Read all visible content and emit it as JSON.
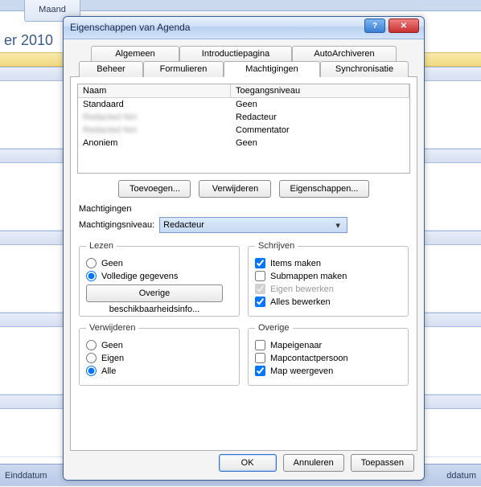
{
  "bg": {
    "maand_tab": "Maand",
    "date_header": "er 2010",
    "foot_left": "Einddatum",
    "foot_right": "ddatum"
  },
  "dialog": {
    "title": "Eigenschappen van Agenda",
    "help": "?",
    "close": "✕",
    "tabs_row1": {
      "algemeen": "Algemeen",
      "intro": "Introductiepagina",
      "autoarch": "AutoArchiveren"
    },
    "tabs_row2": {
      "beheer": "Beheer",
      "formulieren": "Formulieren",
      "machtigingen": "Machtigingen",
      "sync": "Synchronisatie"
    },
    "perm": {
      "col_name": "Naam",
      "col_level": "Toegangsniveau",
      "rows": [
        {
          "name": "Standaard",
          "level": "Geen"
        },
        {
          "name": "Redacted Nm",
          "level": "Redacteur"
        },
        {
          "name": "Redacted Nm",
          "level": "Commentator"
        },
        {
          "name": "Anoniem",
          "level": "Geen"
        }
      ],
      "add": "Toevoegen...",
      "remove": "Verwijderen",
      "props": "Eigenschappen..."
    },
    "section_label": "Machtigingen",
    "level_label": "Machtigingsniveau:",
    "level_value": "Redacteur",
    "read": {
      "legend": "Lezen",
      "none": "Geen",
      "full": "Volledige gegevens",
      "freebusy": "Overige beschikbaarheidsinfo..."
    },
    "write": {
      "legend": "Schrijven",
      "create_items": "Items maken",
      "create_sub": "Submappen maken",
      "edit_own": "Eigen bewerken",
      "edit_all": "Alles bewerken"
    },
    "delete": {
      "legend": "Verwijderen",
      "none": "Geen",
      "own": "Eigen",
      "all": "Alle"
    },
    "other": {
      "legend": "Overige",
      "owner": "Mapeigenaar",
      "contact": "Mapcontactpersoon",
      "visible": "Map weergeven"
    },
    "buttons": {
      "ok": "OK",
      "cancel": "Annuleren",
      "apply": "Toepassen"
    }
  }
}
